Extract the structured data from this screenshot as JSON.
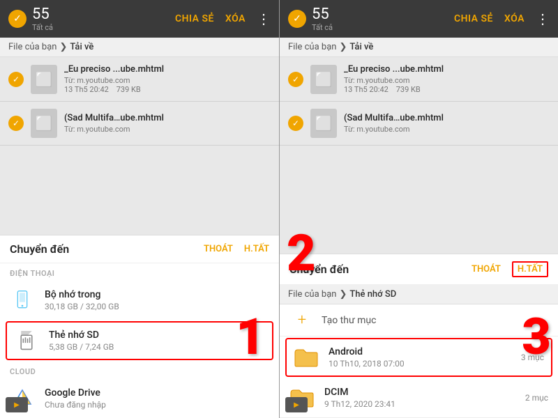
{
  "panel1": {
    "topBar": {
      "checkIcon": "✓",
      "count": "55",
      "subLabel": "Tất cả",
      "shareBtn": "CHIA SẺ",
      "deleteBtn": "XÓA",
      "moreIcon": "⋮"
    },
    "breadcrumb": {
      "root": "File của bạn",
      "arrow": "❯",
      "current": "Tải về"
    },
    "files": [
      {
        "name": "_Eu preciso ...ube.mhtml",
        "source": "Từ: m.youtube.com",
        "date": "13 Th5 20:42",
        "size": "739 KB"
      },
      {
        "name": "(Sad Multifa…ube.mhtml",
        "source": "Từ: m.youtube.com",
        "date": "",
        "size": ""
      }
    ],
    "bottomSheet": {
      "title": "Chuyển đến",
      "exitBtn": "THOÁT",
      "selectAllBtn": "H.TẤT",
      "sectionCloud": "CLOUD",
      "storage": [
        {
          "name": "Bộ nhớ trong",
          "size": "30,18 GB / 32,00 GB",
          "iconType": "phone"
        },
        {
          "name": "Thẻ nhớ SD",
          "size": "5,38 GB / 7,24 GB",
          "iconType": "sdcard",
          "selected": true
        }
      ],
      "cloudItems": [
        {
          "name": "Google Drive",
          "status": "Chưa đăng nhập",
          "iconType": "drive"
        }
      ]
    },
    "annotation": "1"
  },
  "panel2": {
    "topBar": {
      "checkIcon": "✓",
      "count": "55",
      "subLabel": "Tất cả",
      "shareBtn": "CHIA SẺ",
      "deleteBtn": "XÓA",
      "moreIcon": "⋮"
    },
    "breadcrumb": {
      "root": "File của bạn",
      "arrow": "❯",
      "current": "Tải về"
    },
    "files": [
      {
        "name": "_Eu preciso ...ube.mhtml",
        "source": "Từ: m.youtube.com",
        "date": "13 Th5 20:42",
        "size": "739 KB"
      },
      {
        "name": "(Sad Multifa…ube.mhtml",
        "source": "Từ: m.youtube.com",
        "date": "",
        "size": ""
      }
    ],
    "bottomSheet": {
      "title": "Chuyển đến",
      "exitBtn": "THOÁT",
      "selectAllBtn": "H.TẤT",
      "selectAllBordered": true,
      "breadcrumb": {
        "root": "File của bạn",
        "arrow": "❯",
        "current": "Thẻ nhớ SD"
      },
      "createFolder": "Tạo thư mục",
      "folders": [
        {
          "name": "Android",
          "meta": "10 Th10, 2018 07:00",
          "count": "3 mục",
          "selected": true
        },
        {
          "name": "DCIM",
          "meta": "9 Th12, 2020 23:41",
          "count": "2 mục",
          "selected": false
        }
      ]
    },
    "annotations": {
      "two": "2",
      "three": "3"
    }
  }
}
